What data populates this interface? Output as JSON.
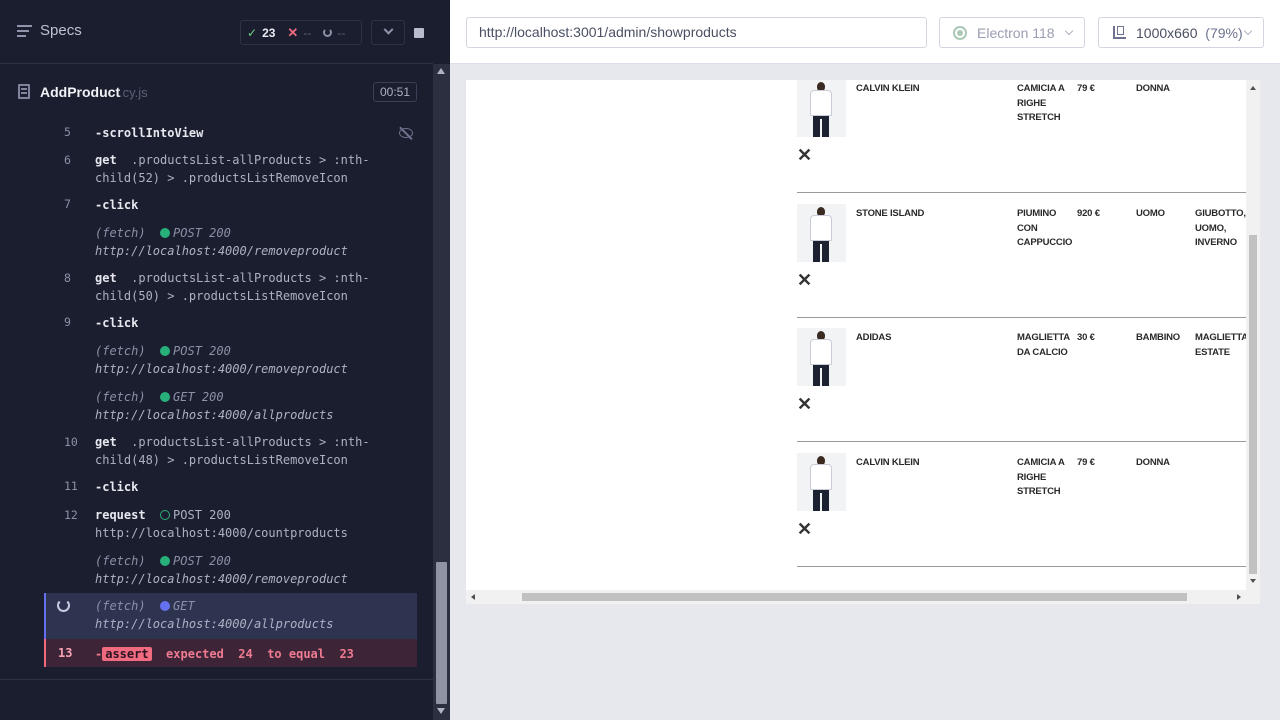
{
  "topbar": {
    "specs_label": "Specs",
    "passed": "23",
    "failed": "--",
    "pending": "--"
  },
  "spec": {
    "name": "AddProduct",
    "ext": ".cy.js",
    "duration": "00:51"
  },
  "commands": [
    {
      "num": "5",
      "name": "-scrollIntoView"
    },
    {
      "num": "6",
      "name": "get",
      "line1": ".productsList-allProducts > :nth-",
      "line2": "child(52) > .productsListRemoveIcon"
    },
    {
      "num": "7",
      "name": "-click"
    },
    {
      "prefix": "(fetch)",
      "method": "POST 200",
      "url": "http://localhost:4000/removeproduct"
    },
    {
      "num": "8",
      "name": "get",
      "line1": ".productsList-allProducts > :nth-",
      "line2": "child(50) > .productsListRemoveIcon"
    },
    {
      "num": "9",
      "name": "-click"
    },
    {
      "prefix": "(fetch)",
      "method": "POST 200",
      "url": "http://localhost:4000/removeproduct"
    },
    {
      "prefix": "(fetch)",
      "method": "GET 200",
      "url": "http://localhost:4000/allproducts"
    },
    {
      "num": "10",
      "name": "get",
      "line1": ".productsList-allProducts > :nth-",
      "line2": "child(48) > .productsListRemoveIcon"
    },
    {
      "num": "11",
      "name": "-click"
    },
    {
      "num": "12",
      "name": "request",
      "method": "POST 200",
      "url": "http://localhost:4000/countproducts"
    },
    {
      "prefix": "(fetch)",
      "method": "POST 200",
      "url": "http://localhost:4000/removeproduct"
    },
    {
      "prefix": "(fetch)",
      "method": "GET",
      "url": "http://localhost:4000/allproducts"
    }
  ],
  "error_row": {
    "num": "13",
    "dash": "-",
    "badge": "assert",
    "msg_a": "expected",
    "expected": "24",
    "msg_b": "to equal",
    "actual": "23"
  },
  "aut": {
    "url": "http://localhost:3001/admin/showproducts",
    "browser": "Electron 118",
    "viewport": "1000x660",
    "zoom": "(79%)"
  },
  "products": [
    {
      "brand": "CALVIN KLEIN",
      "name": "CAMICIA A RIGHE STRETCH",
      "price": "79 €",
      "gender": "DONNA",
      "tags": ""
    },
    {
      "brand": "STONE ISLAND",
      "name": "PIUMINO CON CAPPUCCIO",
      "price": "920 €",
      "gender": "UOMO",
      "tags": "GIUBOTTO, UOMO, INVERNO"
    },
    {
      "brand": "ADIDAS",
      "name": "MAGLIETTA DA CALCIO",
      "price": "30 €",
      "gender": "BAMBINO",
      "tags": "MAGLIETTA, ESTATE"
    },
    {
      "brand": "CALVIN KLEIN",
      "name": "CAMICIA A RIGHE STRETCH",
      "price": "79 €",
      "gender": "DONNA",
      "tags": ""
    }
  ],
  "remove_glyph": "✕",
  "colors": {
    "runner_bg": "#1b1e2e",
    "pass": "#6fd188",
    "fail": "#f06a80",
    "active": "#6470f0",
    "fetch_ok": "#28b07a"
  }
}
